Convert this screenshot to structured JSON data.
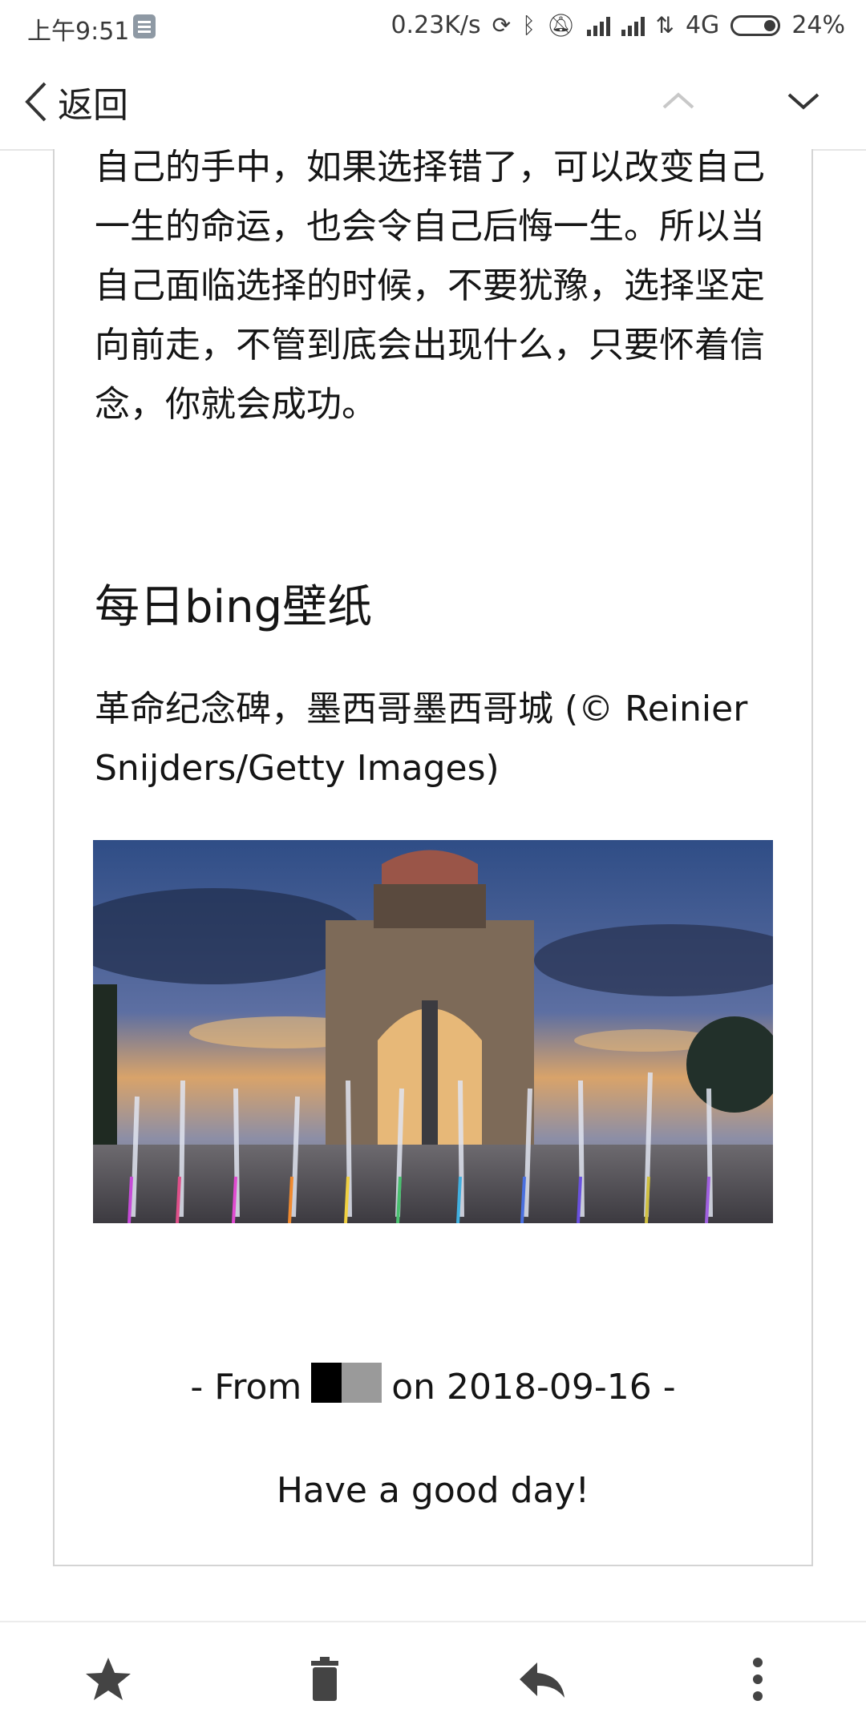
{
  "status_bar": {
    "time": "上午9:51",
    "network_speed": "0.23K/s",
    "network_type": "4G",
    "battery": "24%",
    "icons": [
      "notification-app-icon",
      "sync-icon",
      "bluetooth-icon",
      "mute-icon",
      "signal-icon",
      "hd-signal-icon",
      "data-icon",
      "battery-icon"
    ]
  },
  "top_nav": {
    "back_label": "返回",
    "icons": [
      "back-chevron-icon",
      "previous-message-icon",
      "next-message-icon"
    ]
  },
  "article": {
    "paragraph": "自己的手中，如果选择错了，可以改变自己一生的命运，也会令自己后悔一生。所以当自己面临选择的时候，不要犹豫，选择坚定向前走，不管到底会出现什么，只要怀着信念，你就会成功。",
    "section_title": "每日bing壁纸",
    "image_caption": "革命纪念碑，墨西哥墨西哥城 (© Reinier Snijders/Getty Images)",
    "from_prefix": "- From",
    "from_suffix": "on 2018-09-16 -",
    "greeting": "Have a good day!"
  },
  "bottom_bar": {
    "icons": [
      "star-icon",
      "delete-icon",
      "reply-icon",
      "more-options-icon"
    ]
  },
  "colors": {
    "text": "#151515",
    "frame_border": "#d4d4d4",
    "icon": "#444444"
  }
}
